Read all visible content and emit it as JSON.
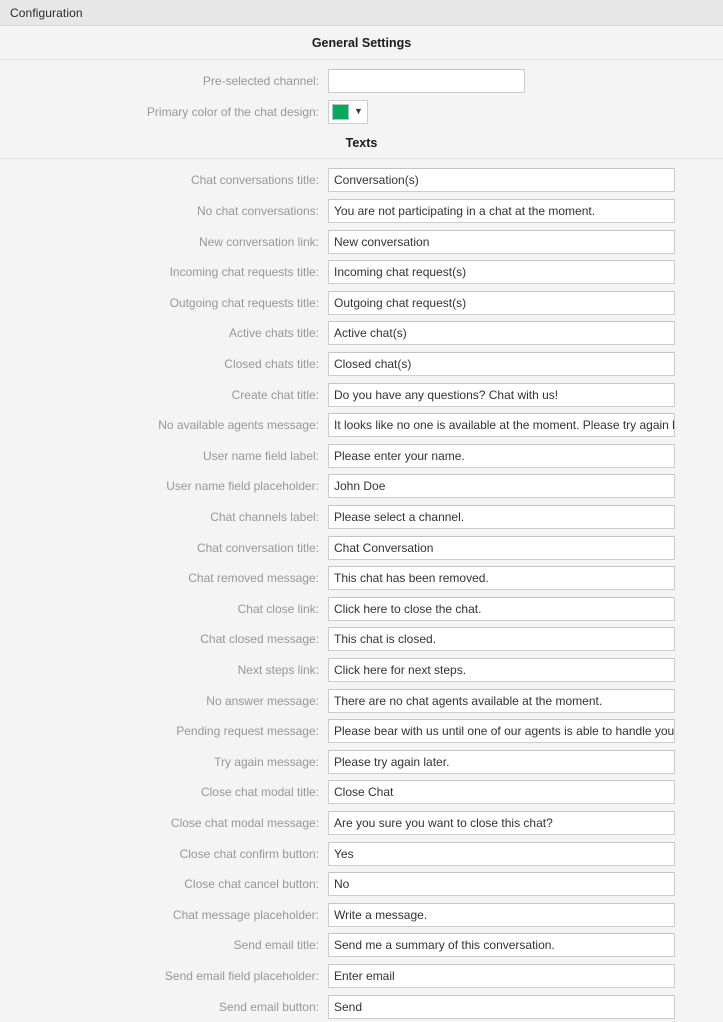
{
  "window": {
    "title": "Configuration"
  },
  "sections": {
    "general": {
      "heading": "General Settings",
      "fields": [
        {
          "label": "Pre-selected channel:",
          "value": "",
          "type": "text",
          "name": "pre-selected-channel"
        },
        {
          "label": "Primary color of the chat design:",
          "value": "#06a95e",
          "type": "color",
          "name": "primary-color",
          "caret": "▼"
        }
      ]
    },
    "texts": {
      "heading": "Texts",
      "fields": [
        {
          "label": "Chat conversations title:",
          "value": "Conversation(s)",
          "name": "chat-conversations-title"
        },
        {
          "label": "No chat conversations:",
          "value": "You are not participating in a chat at the moment.",
          "name": "no-chat-conversations"
        },
        {
          "label": "New conversation link:",
          "value": "New conversation",
          "name": "new-conversation-link"
        },
        {
          "label": "Incoming chat requests title:",
          "value": "Incoming chat request(s)",
          "name": "incoming-chat-requests-title"
        },
        {
          "label": "Outgoing chat requests title:",
          "value": "Outgoing chat request(s)",
          "name": "outgoing-chat-requests-title"
        },
        {
          "label": "Active chats title:",
          "value": "Active chat(s)",
          "name": "active-chats-title"
        },
        {
          "label": "Closed chats title:",
          "value": "Closed chat(s)",
          "name": "closed-chats-title"
        },
        {
          "label": "Create chat title:",
          "value": "Do you have any questions? Chat with us!",
          "name": "create-chat-title"
        },
        {
          "label": "No available agents message:",
          "value": "It looks like no one is available at the moment. Please try again later.",
          "name": "no-available-agents-message"
        },
        {
          "label": "User name field label:",
          "value": "Please enter your name.",
          "name": "user-name-field-label"
        },
        {
          "label": "User name field placeholder:",
          "value": "John Doe",
          "name": "user-name-field-placeholder"
        },
        {
          "label": "Chat channels label:",
          "value": "Please select a channel.",
          "name": "chat-channels-label"
        },
        {
          "label": "Chat conversation title:",
          "value": "Chat Conversation",
          "name": "chat-conversation-title"
        },
        {
          "label": "Chat removed message:",
          "value": "This chat has been removed.",
          "name": "chat-removed-message"
        },
        {
          "label": "Chat close link:",
          "value": "Click here to close the chat.",
          "name": "chat-close-link"
        },
        {
          "label": "Chat closed message:",
          "value": "This chat is closed.",
          "name": "chat-closed-message"
        },
        {
          "label": "Next steps link:",
          "value": "Click here for next steps.",
          "name": "next-steps-link"
        },
        {
          "label": "No answer message:",
          "value": "There are no chat agents available at the moment.",
          "name": "no-answer-message"
        },
        {
          "label": "Pending request message:",
          "value": "Please bear with us until one of our agents is able to handle your request.",
          "name": "pending-request-message"
        },
        {
          "label": "Try again message:",
          "value": "Please try again later.",
          "name": "try-again-message"
        },
        {
          "label": "Close chat modal title:",
          "value": "Close Chat",
          "name": "close-chat-modal-title"
        },
        {
          "label": "Close chat modal message:",
          "value": "Are you sure you want to close this chat?",
          "name": "close-chat-modal-message"
        },
        {
          "label": "Close chat confirm button:",
          "value": "Yes",
          "name": "close-chat-confirm-button"
        },
        {
          "label": "Close chat cancel button:",
          "value": "No",
          "name": "close-chat-cancel-button"
        },
        {
          "label": "Chat message placeholder:",
          "value": "Write a message.",
          "name": "chat-message-placeholder"
        },
        {
          "label": "Send email title:",
          "value": "Send me a summary of this conversation.",
          "name": "send-email-title"
        },
        {
          "label": "Send email field placeholder:",
          "value": "Enter email",
          "name": "send-email-field-placeholder"
        },
        {
          "label": "Send email button:",
          "value": "Send",
          "name": "send-email-button"
        }
      ]
    }
  }
}
